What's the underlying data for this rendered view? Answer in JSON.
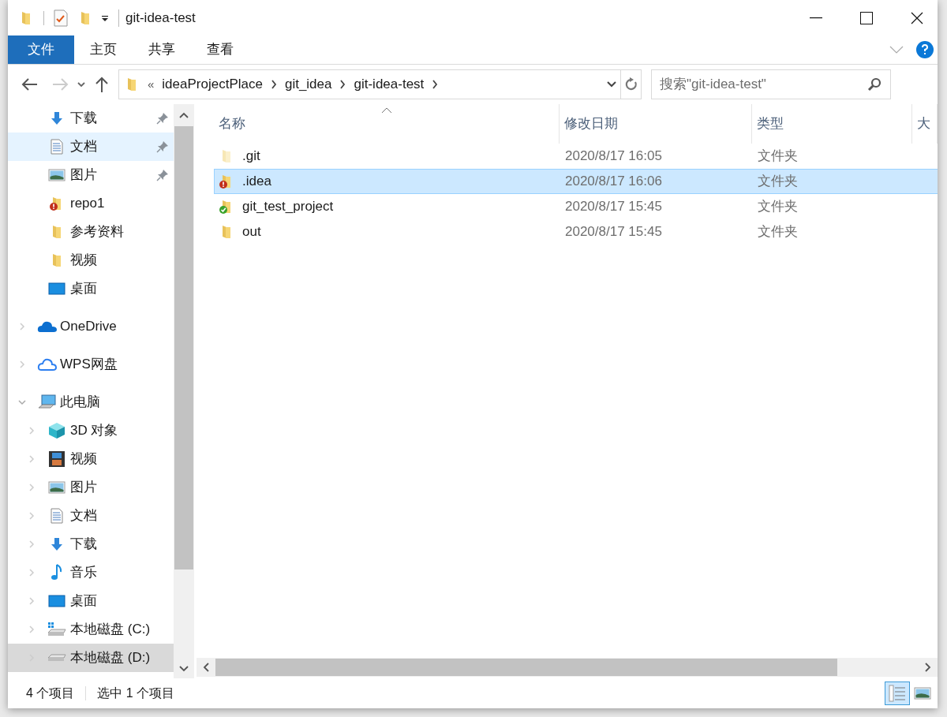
{
  "window": {
    "title": "git-idea-test"
  },
  "ribbon_tabs": [
    {
      "label": "文件",
      "kind": "file",
      "selected": false
    },
    {
      "label": "主页",
      "kind": "tab",
      "selected": false
    },
    {
      "label": "共享",
      "kind": "tab",
      "selected": false
    },
    {
      "label": "查看",
      "kind": "tab",
      "selected": false
    }
  ],
  "address_bar": {
    "overflow": "«",
    "crumbs": [
      "ideaProjectPlace",
      "git_idea",
      "git-idea-test"
    ]
  },
  "search": {
    "placeholder": "搜索\"git-idea-test\""
  },
  "navigation": [
    {
      "label": "下载",
      "kind": "download",
      "pinned": true,
      "hovered": false,
      "selected": false
    },
    {
      "label": "文档",
      "kind": "document",
      "pinned": true,
      "hovered": true,
      "selected": false
    },
    {
      "label": "图片",
      "kind": "pictures",
      "pinned": true,
      "hovered": false,
      "selected": false
    },
    {
      "label": "repo1",
      "kind": "folder-conflict",
      "pinned": false,
      "hovered": false,
      "selected": false
    },
    {
      "label": "参考资料",
      "kind": "folder",
      "pinned": false,
      "hovered": false,
      "selected": false
    },
    {
      "label": "视频",
      "kind": "folder",
      "pinned": false,
      "hovered": false,
      "selected": false
    },
    {
      "label": "桌面",
      "kind": "desktop",
      "pinned": false,
      "hovered": false,
      "selected": false
    }
  ],
  "locations": [
    {
      "label": "OneDrive",
      "kind": "cloud",
      "expanded": false,
      "selected": false
    },
    {
      "label": "WPS网盘",
      "kind": "cloud-outline",
      "expanded": false,
      "selected": false
    },
    {
      "label": "此电脑",
      "kind": "computer",
      "expanded": true,
      "selected": false,
      "children": [
        {
          "label": "3D 对象",
          "kind": "cube",
          "selected": false
        },
        {
          "label": "视频",
          "kind": "video",
          "selected": false
        },
        {
          "label": "图片",
          "kind": "pictures",
          "selected": false
        },
        {
          "label": "文档",
          "kind": "document",
          "selected": false
        },
        {
          "label": "下载",
          "kind": "download",
          "selected": false
        },
        {
          "label": "音乐",
          "kind": "music",
          "selected": false
        },
        {
          "label": "桌面",
          "kind": "desktop",
          "selected": false
        },
        {
          "label": "本地磁盘 (C:)",
          "kind": "system-drive",
          "selected": false
        },
        {
          "label": "本地磁盘 (D:)",
          "kind": "drive",
          "selected": true
        }
      ]
    }
  ],
  "table": {
    "columns": [
      "名称",
      "修改日期",
      "类型",
      "大"
    ],
    "rows": [
      {
        "name": ".git",
        "modified": "2020/8/17 16:05",
        "type": "文件夹",
        "kind": "hidden-folder",
        "selected": false
      },
      {
        "name": ".idea",
        "modified": "2020/8/17 16:06",
        "type": "文件夹",
        "kind": "conflict-folder",
        "selected": true
      },
      {
        "name": "git_test_project",
        "modified": "2020/8/17 15:45",
        "type": "文件夹",
        "kind": "ok-folder",
        "selected": false
      },
      {
        "name": "out",
        "modified": "2020/8/17 15:45",
        "type": "文件夹",
        "kind": "folder",
        "selected": false
      }
    ]
  },
  "status_bar": {
    "count": "4 个项目",
    "selection": "选中 1 个项目",
    "details_view": true
  }
}
